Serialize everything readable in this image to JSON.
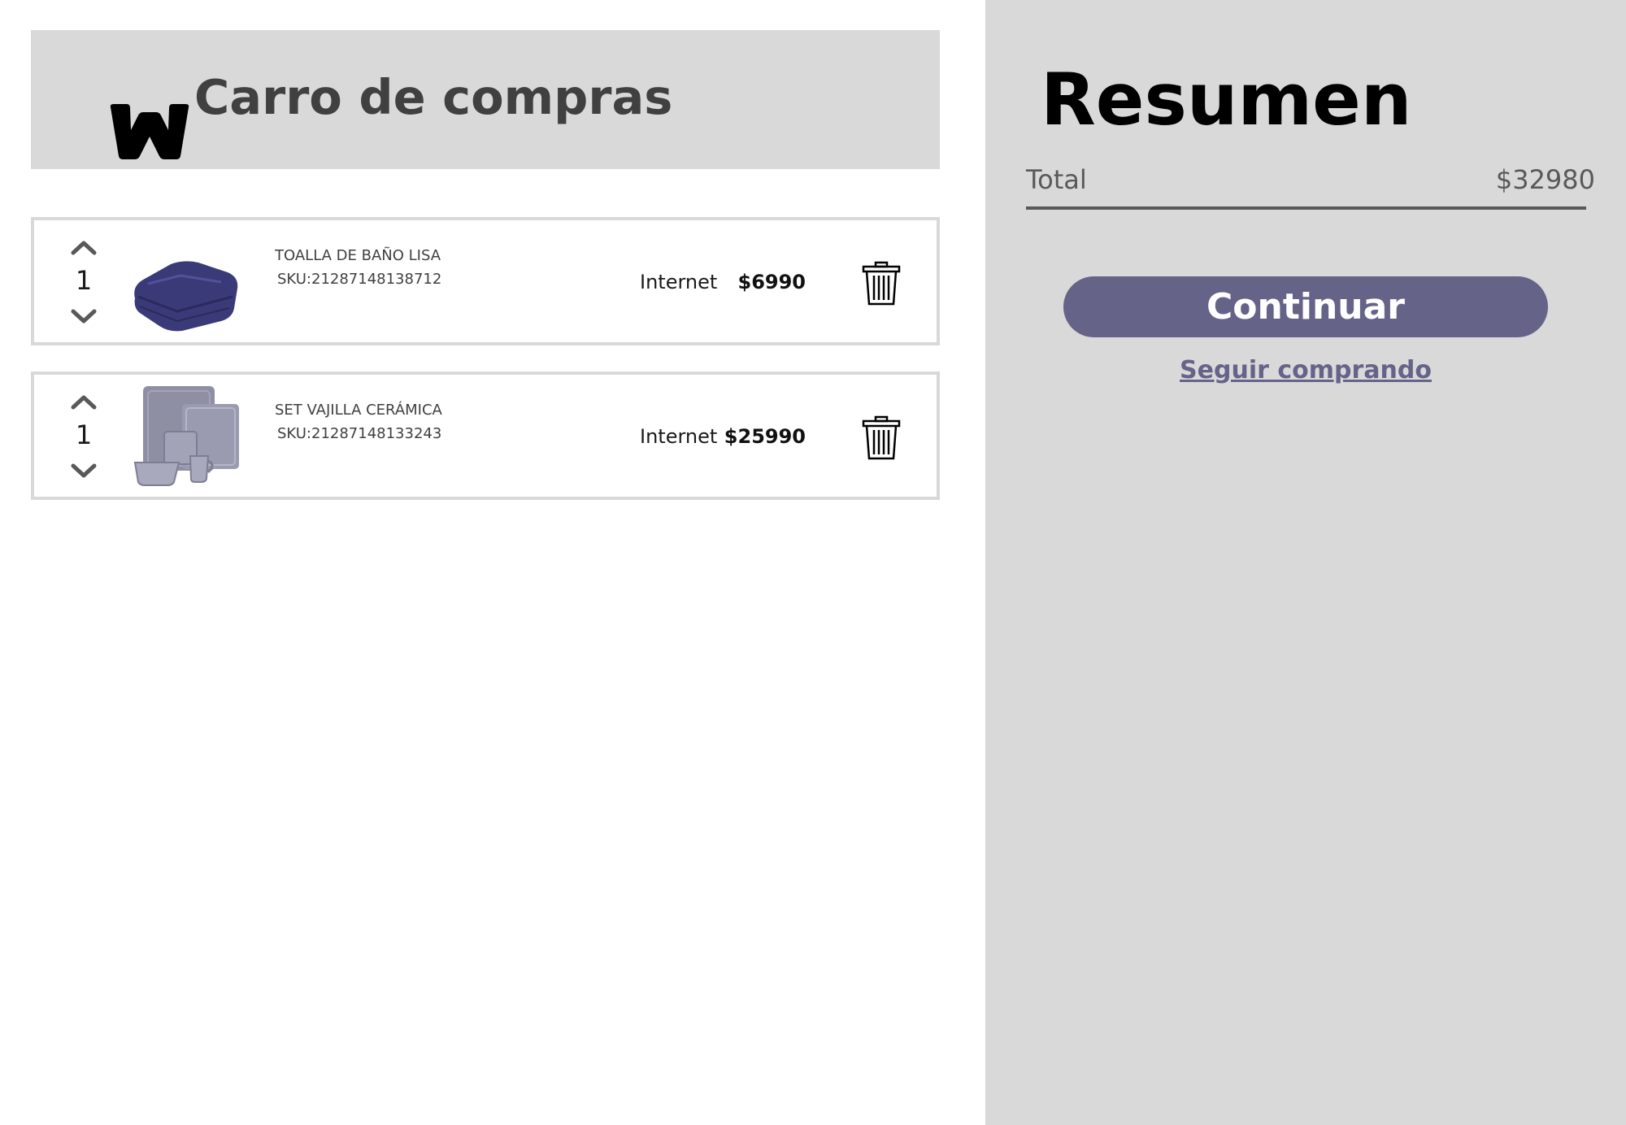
{
  "header": {
    "logo_icon": "w-logo-icon",
    "title": "Carro de compras"
  },
  "cart": {
    "items": [
      {
        "quantity": "1",
        "name": "TOALLA DE BAÑO LISA",
        "sku": "SKU:21287148138712",
        "channel": "Internet",
        "price": "$6990",
        "image_icon": "folded-towel-icon"
      },
      {
        "quantity": "1",
        "name": "SET VAJILLA CERÁMICA",
        "sku": "SKU:21287148133243",
        "channel": "Internet",
        "price": "$25990",
        "image_icon": "dinnerware-set-icon"
      }
    ]
  },
  "summary": {
    "title": "Resumen",
    "total_label": "Total",
    "total_value": "$32980",
    "continue_label": "Continuar",
    "continue_shopping_label": "Seguir comprando"
  },
  "colors": {
    "panel_gray": "#d9d9d9",
    "accent": "#666389",
    "text_dark": "#404040",
    "text_mid": "#595959"
  }
}
